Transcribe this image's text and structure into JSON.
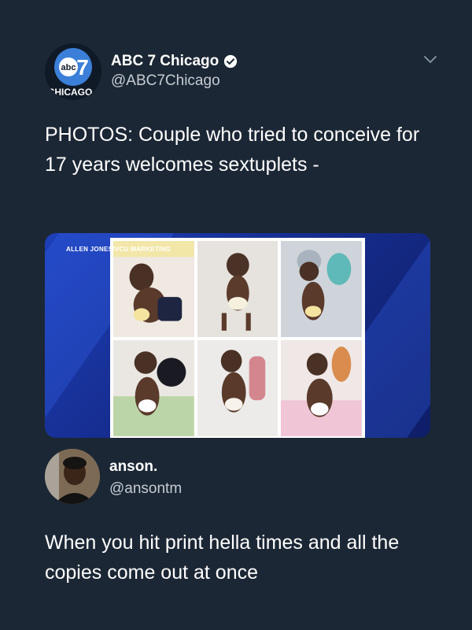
{
  "tweet": {
    "author": {
      "display_name": "ABC 7 Chicago",
      "handle": "@ABC7Chicago",
      "avatar_text": "abc",
      "avatar_number": "7",
      "avatar_city": "CHICAGO",
      "verified": true
    },
    "text": "PHOTOS: Couple who tried to conceive for 17 years welcomes sextuplets -",
    "media": {
      "photo_credit": "ALLEN JONES/VCU MARKETING",
      "photo_count": 6
    }
  },
  "reply": {
    "author": {
      "display_name": "anson.",
      "handle": "@ansontm"
    },
    "text": "When you hit print hella times and all the copies come out at once"
  },
  "colors": {
    "background": "#1c2735",
    "verified": "#ffffff",
    "card_blue": "#1d3fb8"
  }
}
